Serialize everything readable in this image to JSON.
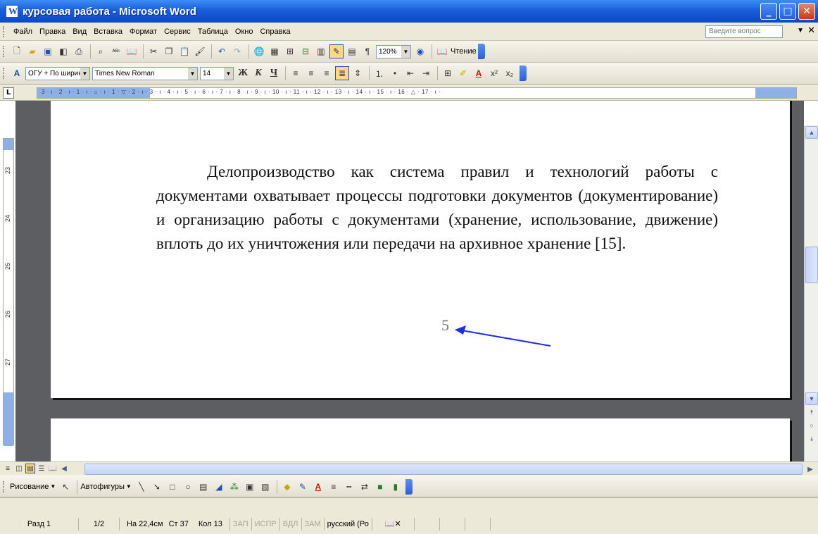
{
  "window": {
    "title": "курсовая работа - Microsoft Word"
  },
  "menu": {
    "items": [
      "Файл",
      "Правка",
      "Вид",
      "Вставка",
      "Формат",
      "Сервис",
      "Таблица",
      "Окно",
      "Справка"
    ],
    "help_placeholder": "Введите вопрос"
  },
  "standard_toolbar": {
    "zoom": "120%",
    "reading_label": "Чтение"
  },
  "formatting_toolbar": {
    "style": "ОГУ + По ширин",
    "font": "Times New Roman",
    "size": "14",
    "bold": "Ж",
    "italic": "К",
    "underline": "Ч"
  },
  "ruler": {
    "tab_selector": "L",
    "scale": "3 · ı · 2 · ı · 1 · ı · ⌂ · ı · 1 · ▽ · 2 · ı · 3 · ı · 4 · ı · 5 · ı · 6 · ı · 7 · ı · 8 · ı · 9 · ı · 10 · ı · 11 · ı · 12 · ı · 13 · ı · 14 · ı · 15 · ı · 16 · △ · 17 · ı ·",
    "vertical_numbers": [
      "23",
      "24",
      "25",
      "26",
      "27"
    ]
  },
  "document": {
    "paragraph": "Делопроизводство как система правил и технологий работы с документами охватывает процессы подготовки документов (документирование) и организацию работы с документами (хранение, использование, движение) вплоть до их уничтожения или передачи на архивное хранение [15].",
    "page_number": "5"
  },
  "annotation": {
    "arrow_color": "#1f2ee0"
  },
  "drawing_toolbar": {
    "drawing_label": "Рисование",
    "autoshapes_label": "Автофигуры"
  },
  "status": {
    "section": "Разд 1",
    "pages": "1/2",
    "position": "На 22,4см",
    "line": "Ст 37",
    "column": "Кол 13",
    "rec": "ЗАП",
    "trk": "ИСПР",
    "ext": "ВДЛ",
    "ovr": "ЗАМ",
    "language": "русский (Ро"
  }
}
